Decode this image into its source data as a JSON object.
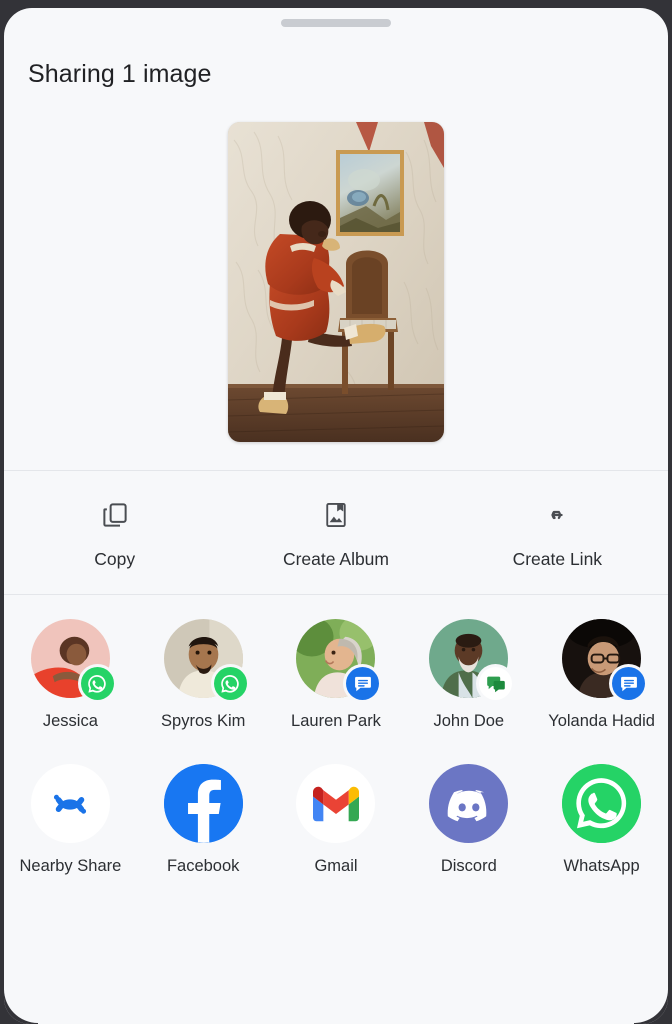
{
  "sheet": {
    "title": "Sharing 1 image",
    "drag_handle": "drag-handle",
    "background_color": "#f7f8fa",
    "frame_color": "#333338"
  },
  "preview": {
    "alt": "Person in rust-red outfit leaning toward a wooden chair beside a framed painting on a textured cream wall",
    "count": 1
  },
  "actions": [
    {
      "label": "Copy",
      "icon": "copy-icon"
    },
    {
      "label": "Create Album",
      "icon": "album-icon"
    },
    {
      "label": "Create Link",
      "icon": "link-icon"
    }
  ],
  "contacts": [
    {
      "name": "Jessica",
      "badge": "whatsapp-badge",
      "badge_color": "#25d366"
    },
    {
      "name": "Spyros Kim",
      "badge": "whatsapp-badge",
      "badge_color": "#25d366"
    },
    {
      "name": "Lauren Park",
      "badge": "messages-badge",
      "badge_color": "#1a73e8"
    },
    {
      "name": "John Doe",
      "badge": "sms-badge",
      "badge_color": "#ffffff"
    },
    {
      "name": "Yolanda Hadid",
      "badge": "messages-badge",
      "badge_color": "#1a73e8"
    }
  ],
  "apps": [
    {
      "name": "Nearby Share",
      "icon": "nearby-share-icon",
      "color": "#1a73e8",
      "bg": "#ffffff"
    },
    {
      "name": "Facebook",
      "icon": "facebook-icon",
      "color": "#ffffff",
      "bg": "#1877f2"
    },
    {
      "name": "Gmail",
      "icon": "gmail-icon",
      "color": "#ea4335",
      "bg": "#ffffff"
    },
    {
      "name": "Discord",
      "icon": "discord-icon",
      "color": "#ffffff",
      "bg": "#6b76c4"
    },
    {
      "name": "WhatsApp",
      "icon": "whatsapp-icon",
      "color": "#ffffff",
      "bg": "#25d366"
    }
  ]
}
